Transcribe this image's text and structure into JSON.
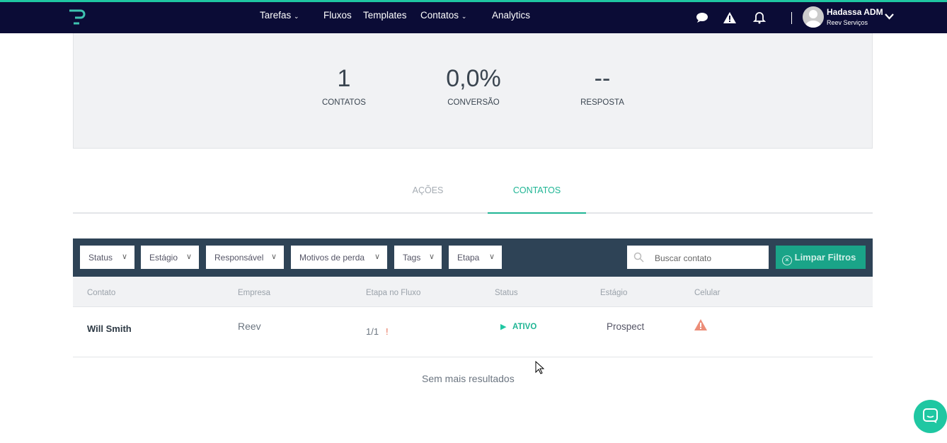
{
  "nav": {
    "items": [
      "Tarefas",
      "Fluxos",
      "Templates",
      "Contatos",
      "Analytics"
    ],
    "user_name": "Hadassa ADM",
    "user_company": "Reev Serviços"
  },
  "stats": [
    {
      "value": "1",
      "label": "CONTATOS"
    },
    {
      "value": "0,0%",
      "label": "CONVERSÃO"
    },
    {
      "value": "--",
      "label": "RESPOSTA"
    }
  ],
  "tabs": [
    "AÇÕES",
    "CONTATOS"
  ],
  "filters": [
    "Status",
    "Estágio",
    "Responsável",
    "Motivos de perda",
    "Tags",
    "Etapa"
  ],
  "search": {
    "placeholder": "Buscar contato"
  },
  "clear_label": "Limpar Filtros",
  "columns": [
    "Contato",
    "Empresa",
    "Etapa no Fluxo",
    "Status",
    "Estágio",
    "Celular"
  ],
  "rows": [
    {
      "contato": "Will Smith",
      "empresa": "Reev",
      "etapa": "1/1",
      "alert": "!",
      "status": "ATIVO",
      "estagio": "Prospect"
    }
  ],
  "footer": "Sem mais resultados",
  "colors": {
    "accent": "#1fc7a2",
    "navbar": "#0b0c36",
    "filterbar": "#2e4356"
  }
}
